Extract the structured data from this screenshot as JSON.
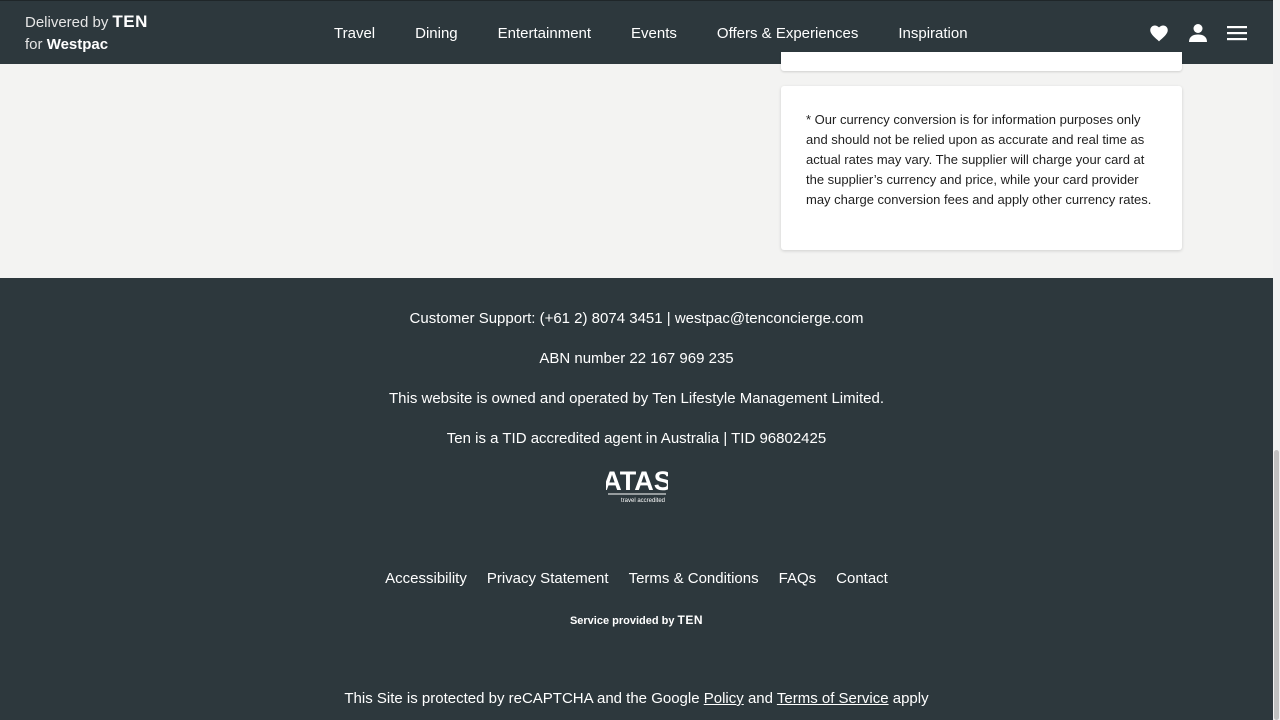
{
  "header": {
    "brand_line1": "Delivered by",
    "brand_ten": "TEN",
    "brand_line2_prefix": "for",
    "brand_line2_name": "Westpac",
    "nav": [
      "Travel",
      "Dining",
      "Entertainment",
      "Events",
      "Offers & Experiences",
      "Inspiration"
    ],
    "icons": [
      "heart-icon",
      "user-icon",
      "menu-icon"
    ]
  },
  "card": {
    "disclaimer": "* Our currency conversion is for information purposes only and should not be relied upon as accurate and real time as actual rates may vary. The supplier will charge your card at the supplier’s currency and price, while your card provider may charge conversion fees and apply other currency rates."
  },
  "footer": {
    "support": "Customer Support: (+61 2) 8074 3451 | westpac@tenconcierge.com",
    "abn": "ABN number 22 167 969 235",
    "owned": "This website is owned and operated by Ten Lifestyle Management Limited.",
    "tid": "Ten is a TID accredited agent in Australia | TID 96802425",
    "atas_logo": "ATAS",
    "atas_sub": "travel accredited",
    "links": [
      "Accessibility",
      "Privacy Statement",
      "Terms & Conditions",
      "FAQs",
      "Contact"
    ],
    "service_prefix": "Service provided by",
    "service_ten": "TEN",
    "recaptcha_prefix": "This Site is protected by reCAPTCHA and the Google",
    "recaptcha_policy": "Policy",
    "recaptcha_and": "and",
    "recaptcha_terms": "Terms of Service",
    "recaptcha_suffix": "apply"
  },
  "colors": {
    "header_bg": "#2d383d",
    "footer_bg": "#2d383d",
    "page_bg": "#f3f3f2"
  }
}
